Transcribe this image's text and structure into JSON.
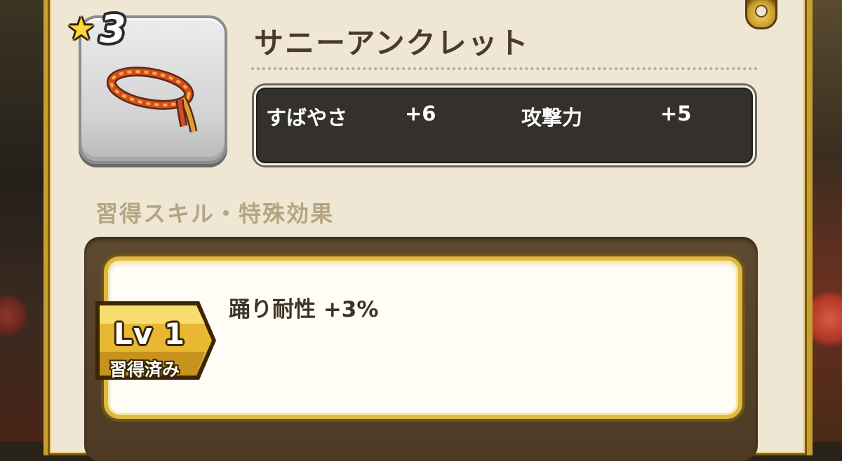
{
  "item": {
    "rarity": "3",
    "name": "サニーアンクレット",
    "icon": "anklet-icon"
  },
  "stats": [
    {
      "name": "すばやさ",
      "value": "+6"
    },
    {
      "name": "攻撃力",
      "value": "+5"
    }
  ],
  "skills_section": {
    "label": "習得スキル・特殊効果"
  },
  "skills": [
    {
      "level": "Lv 1",
      "status": "習得済み",
      "effect": "踊り耐性 +3%"
    }
  ],
  "colors": {
    "panel": "#efe6d3",
    "gold_frame": "#ddb940",
    "stats_box": "#34312c",
    "section_label": "#b5a482"
  }
}
